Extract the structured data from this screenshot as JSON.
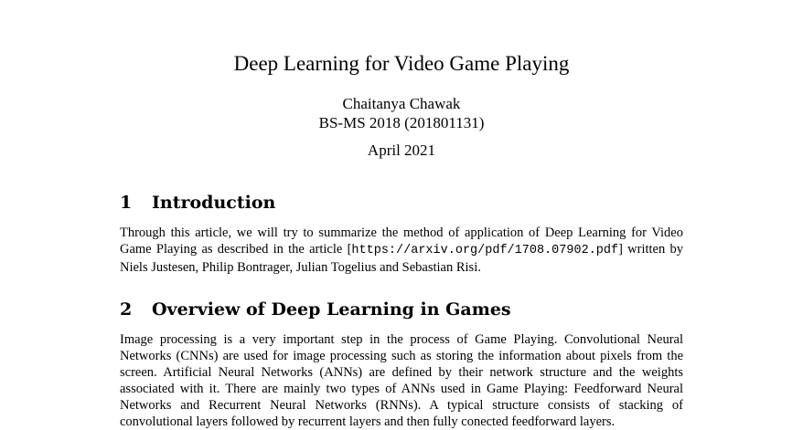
{
  "document": {
    "title": "Deep Learning for Video Game Playing",
    "author": "Chaitanya Chawak",
    "program": "BS-MS 2018 (201801131)",
    "date": "April 2021"
  },
  "sections": [
    {
      "number": "1",
      "heading": "Introduction",
      "para_before_link": "Through this article, we will try to summarize the method of application of Deep Learning for Video Game Playing as described in the article [",
      "link": "https://arxiv.org/pdf/1708.07902.pdf",
      "para_after_link": "] written by Niels Justesen, Philip Bontrager, Julian Togelius and Sebastian Risi."
    },
    {
      "number": "2",
      "heading": "Overview of Deep Learning in Games",
      "paragraph": "Image processing is a very important step in the process of Game Playing. Convolutional Neural Networks (CNNs) are used for image processing such as storing the information about pixels from the screen. Artificial Neural Networks (ANNs) are defined by their network structure and the weights associated with it. There are mainly two types of ANNs used in Game Playing: Feedforward Neural Networks and Recurrent Neural Networks (RNNs). A typical structure consists of stacking of convolutional layers followed by recurrent layers and then fully conected feedforward layers."
    }
  ]
}
